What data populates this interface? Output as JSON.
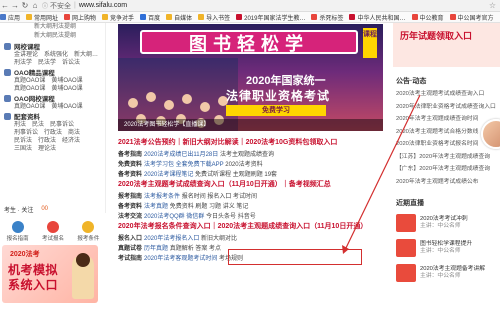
{
  "browser": {
    "insecure_label": "不安全",
    "url": "www.sifalu.com",
    "bookmarks": [
      {
        "label": "应用",
        "color": "#4a78c9"
      },
      {
        "label": "常用网址",
        "color": "#f0b429"
      },
      {
        "label": "网上购物",
        "color": "#e8453c"
      },
      {
        "label": "竞争对手",
        "color": "#f0b429"
      },
      {
        "label": "百度",
        "color": "#2f6fd8"
      },
      {
        "label": "自媒体",
        "color": "#f0b429"
      },
      {
        "label": "导入书签",
        "color": "#f0b429"
      },
      {
        "label": "2019年国家法学生教…",
        "color": "#c8102e"
      },
      {
        "label": "杀死标签",
        "color": "#e8453c"
      },
      {
        "label": "中华人民共和国…",
        "color": "#c8102e"
      },
      {
        "label": "中公教育",
        "color": "#e8453c"
      },
      {
        "label": "中公国考官方",
        "color": "#e8453c"
      }
    ]
  },
  "sidebar": {
    "subs": [
      "新大纲刑法提纲",
      "新大纲民法提纲"
    ],
    "groups": [
      {
        "title": "网校课程",
        "rows": [
          [
            "金讲理论",
            "系统强化",
            "新大纲…"
          ],
          [
            "刑法学",
            "民法学",
            "诉讼法"
          ]
        ],
        "color": "#5a7bb5"
      },
      {
        "title": "OAO精品课程",
        "rows": [
          [
            "真题OAO课",
            "黄埔OAO课"
          ],
          [
            "真题OAO课",
            "黄埔OAO课"
          ]
        ],
        "color": "#5a7bb5"
      },
      {
        "title": "OAO网校课程",
        "rows": [
          [
            "真题OAO课",
            "黄埔OAO课"
          ]
        ],
        "color": "#5a7bb5"
      },
      {
        "title": "配套资料",
        "rows": [
          [
            "刑法",
            "民法",
            "民事诉讼"
          ],
          [
            "刑事诉讼",
            "行政法",
            "商法"
          ],
          [
            "民诉法",
            "行政法",
            "经济法"
          ],
          [
            "三国法",
            "理论法"
          ]
        ],
        "color": "#5a7bb5"
      }
    ],
    "mini_info": {
      "label": "考生 · 关注",
      "count": "00"
    },
    "mini_icons": [
      {
        "label": "报名指南",
        "color": "#3b82c8"
      },
      {
        "label": "考试报名",
        "color": "#e8453c"
      },
      {
        "label": "报考条件",
        "color": "#f0b429"
      }
    ],
    "promo": {
      "year": "2020法考",
      "line1": "机考模拟",
      "line2": "系统入口"
    }
  },
  "banner": {
    "title": "图书轻松学",
    "badge": "课程",
    "line1": "2020年国家统一",
    "line2": "法律职业资格考试",
    "line3": "免费学习",
    "caption": "2020法考图书轻松学【直播课】"
  },
  "articles": [
    {
      "type": "head",
      "text": "2021法考公告预约｜新旧大纲对比解读｜2020法考10G资料包领取入口"
    },
    {
      "type": "row",
      "label": "备考指南",
      "text": "2020法考成绩已出11月28日",
      "text2": "法考主观题成绩查询"
    },
    {
      "type": "row",
      "label": "免费资料",
      "text": "法考学习包 全套免费下载APP",
      "text2": "2020法考资料"
    },
    {
      "type": "row",
      "label": "备考资料",
      "text": "2020法考课程笔记",
      "text2": "免费试听课程 主观题刷题 19套"
    },
    {
      "type": "head",
      "text": "2020法考主观题考试成绩查询入口（11月10日开通）｜备考视频汇总"
    },
    {
      "type": "row",
      "label": "报考指南",
      "text": "法考报考条件",
      "text2": "报名时间 报名入口 考试时间"
    },
    {
      "type": "row",
      "label": "备考资料",
      "text": "法考真题",
      "text2": "免费资料 刷题 习题 讲义 笔记"
    },
    {
      "type": "row",
      "label": "法考交流",
      "text": "2020法考QQ群 微信群",
      "text2": "今日头条号 抖音号"
    },
    {
      "type": "head",
      "text": "2020年法考报名条件查询入口｜2020法考主观题成绩查询入口（11月10日开通）"
    },
    {
      "type": "row",
      "label": "报名入口",
      "text": "2020年法考报名入口",
      "text2": "新旧大纲对比"
    },
    {
      "type": "row",
      "label": "真题试卷",
      "text": "历年真题",
      "text2": "真题解析 答案 考点"
    },
    {
      "type": "row",
      "label": "考试指南",
      "text": "2020年法考客观题考试时间",
      "text2": "考场规则"
    }
  ],
  "right": {
    "top_title": "历年试题领取入口",
    "notice_title": "公告·动态",
    "notices": [
      "2020法考主观题考试成绩查询入口",
      "2020年法律职业资格考试成绩查询入口",
      "2020年法考主观题成绩查询时间",
      "2020法考主观题考试合格分数线",
      "2020法律职业资格考试报名时间",
      "【江苏】2020年法考主观题成绩查询",
      "【广东】2020年法考主观题成绩查询",
      "2020年法考主观题考试成绩公布"
    ],
    "live_title": "近期直播",
    "lives": [
      {
        "title": "2020法考考试冲刺",
        "sub": "主讲：中公名师"
      },
      {
        "title": "图书轻松学课程提升",
        "sub": "主讲：中公名师"
      },
      {
        "title": "2020法考主观题备考讲解",
        "sub": "主讲：中公名师"
      }
    ]
  }
}
